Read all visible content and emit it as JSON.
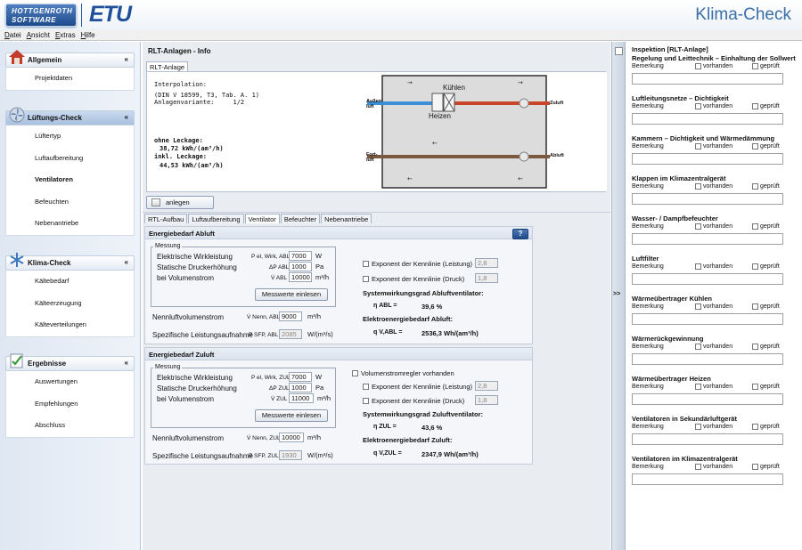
{
  "header": {
    "brand_line1": "HOTTGENROTH",
    "brand_line2": "SOFTWARE",
    "product": "ETU",
    "app_title": "Klima-Check"
  },
  "menu": [
    {
      "pre": "",
      "u": "D",
      "post": "atei"
    },
    {
      "pre": "",
      "u": "A",
      "post": "nsicht"
    },
    {
      "pre": "",
      "u": "E",
      "post": "xtras"
    },
    {
      "pre": "",
      "u": "H",
      "post": "ilfe"
    }
  ],
  "sidebar": {
    "sections": [
      {
        "label": "Allgemein",
        "chevron": "«",
        "icon": "house-icon",
        "items": [
          {
            "label": "Projektdaten",
            "bold": false
          }
        ]
      },
      {
        "label": "Lüftungs-Check",
        "chevron": "«",
        "icon": "fan-icon",
        "active": true,
        "items": [
          {
            "label": "Lüftertyp",
            "bold": false
          },
          {
            "label": "Luftaufbereitung",
            "bold": false
          },
          {
            "label": "Ventilatoren",
            "bold": true
          },
          {
            "label": "Befeuchten",
            "bold": false
          },
          {
            "label": "Nebenantriebe",
            "bold": false
          }
        ]
      },
      {
        "label": "Klima-Check",
        "chevron": "«",
        "icon": "snowflake-icon",
        "items": [
          {
            "label": "Kältebedarf",
            "bold": false
          },
          {
            "label": "Kälteerzeugung",
            "bold": false
          },
          {
            "label": "Kälteverteilungen",
            "bold": false
          }
        ]
      },
      {
        "label": "Ergebnisse",
        "chevron": "«",
        "icon": "results-icon",
        "items": [
          {
            "label": "Auswertungen",
            "bold": false
          },
          {
            "label": "Empfehlungen",
            "bold": false
          },
          {
            "label": "Abschluss",
            "bold": false
          }
        ]
      }
    ]
  },
  "main": {
    "title": "RLT-Anlagen - Info",
    "top_tab": "RLT-Anlage",
    "info": {
      "line1": "Interpolation:",
      "line2": "(DIN V 18599, T3, Tab. A. 1)",
      "line3": "Anlagenvariante:     1/2",
      "ohne_label": "ohne Leckage:",
      "ohne_value": "38,72 kWh/(am³/h)",
      "inkl_label": "inkl. Leckage:",
      "inkl_value": "44,53 kWh/(am³/h)"
    },
    "diagram": {
      "kuehlen": "Kühlen",
      "heizen": "Heizen",
      "aussenluft_1": "Außen-",
      "aussenluft_2": "luft",
      "zuluft": "Zuluft",
      "fortluft_1": "Fort-",
      "fortluft_2": "luft",
      "abluft": "Abluft"
    },
    "anlegen_label": "anlegen",
    "tabs": [
      "RTL-Aufbau",
      "Luftaufbereitung",
      "Ventilator",
      "Befeuchter",
      "Nebenantriebe"
    ],
    "active_tab_index": 2,
    "abluft": {
      "title": "Energiebedarf Abluft",
      "help": "?",
      "legend": "Messung",
      "wirk_label": "Elektrische Wirkleistung",
      "wirk_sym": "P el, Wirk, ABL",
      "wirk_value": "7000",
      "wirk_unit": "W",
      "druck_label": "Statische Druckerhöhung",
      "druck_sym": "ΔP ABL",
      "druck_value": "1000",
      "druck_unit": "Pa",
      "vol_label": "bei Volumenstrom",
      "vol_sym": "V̇ ABL",
      "vol_value": "10000",
      "vol_unit": "m³/h",
      "mess_btn": "Messwerte einlesen",
      "nenn_label": "Nennluftvolumenstrom",
      "nenn_sym": "V̇ Nenn, ABL",
      "nenn_value": "9000",
      "nenn_unit": "m³/h",
      "spez_label": "Spezifische Leistungsaufnahme",
      "spez_sym": "P SFP, ABL",
      "spez_value": "2085",
      "spez_unit": "W/(m³/s)",
      "exp_leistung": "Exponent der Kennlinie (Leistung)",
      "exp_leistung_val": "2,8",
      "exp_druck": "Exponent der Kennlinie (Druck)",
      "exp_druck_val": "1,8",
      "sys_title": "Systemwirkungsgrad Abluftventilator:",
      "eta_sym": "η ABL =",
      "eta_val": "39,6 %",
      "el_title": "Elektroenergiebedarf Abluft:",
      "q_sym": "q V,ABL =",
      "q_val": "2536,3 Wh/(am³/h)"
    },
    "zuluft": {
      "title": "Energiebedarf Zuluft",
      "legend": "Messung",
      "wirk_label": "Elektrische Wirkleistung",
      "wirk_sym": "P el, Wirk, ZUL",
      "wirk_value": "7000",
      "wirk_unit": "W",
      "druck_label": "Statische Druckerhöhung",
      "druck_sym": "ΔP ZUL",
      "druck_value": "1000",
      "druck_unit": "Pa",
      "vol_label": "bei Volumenstrom",
      "vol_sym": "V̇ ZUL",
      "vol_value": "11000",
      "vol_unit": "m³/h",
      "mess_btn": "Messwerte einlesen",
      "nenn_label": "Nennluftvolumenstrom",
      "nenn_sym": "V̇ Nenn, ZUL",
      "nenn_value": "10000",
      "nenn_unit": "m³/h",
      "spez_label": "Spezifische Leistungsaufnahme",
      "spez_sym": "P SFP, ZUL",
      "spez_value": "1930",
      "spez_unit": "W/(m³/s)",
      "vreg": "Volumenstromregler vorhanden",
      "exp_leistung": "Exponent der Kennlinie (Leistung)",
      "exp_leistung_val": "2,8",
      "exp_druck": "Exponent der Kennlinie (Druck)",
      "exp_druck_val": "1,8",
      "sys_title": "Systemwirkungsgrad Zuluftventilator:",
      "eta_sym": "η ZUL =",
      "eta_val": "43,6 %",
      "el_title": "Elektroenergiebedarf Zuluft:",
      "q_sym": "q V,ZUL =",
      "q_val": "2347,9 Wh/(am³/h)"
    }
  },
  "strip": {
    "toggle": ">>"
  },
  "inspection": {
    "title": "Inspektion [RLT-Anlage]",
    "bemerkung": "Bemerkung",
    "vorhanden": "vorhanden",
    "geprueft": "geprüft",
    "items": [
      "Regelung und Leittechnik – Einhaltung der Sollwert",
      "Luftleitungsnetze – Dichtigkeit",
      "Kammern – Dichtigkeit und Wärmedämmung",
      "Klappen im Klimazentralgerät",
      "Wasser- / Dampfbefeuchter",
      "Luftfilter",
      "Wärmeübertrager Kühlen",
      "Wärmerückgewinnung",
      "Wärmeübertrager Heizen",
      "Ventilatoren in Sekundärluftgerät",
      "Ventilatoren im Klimazentralgerät"
    ]
  }
}
